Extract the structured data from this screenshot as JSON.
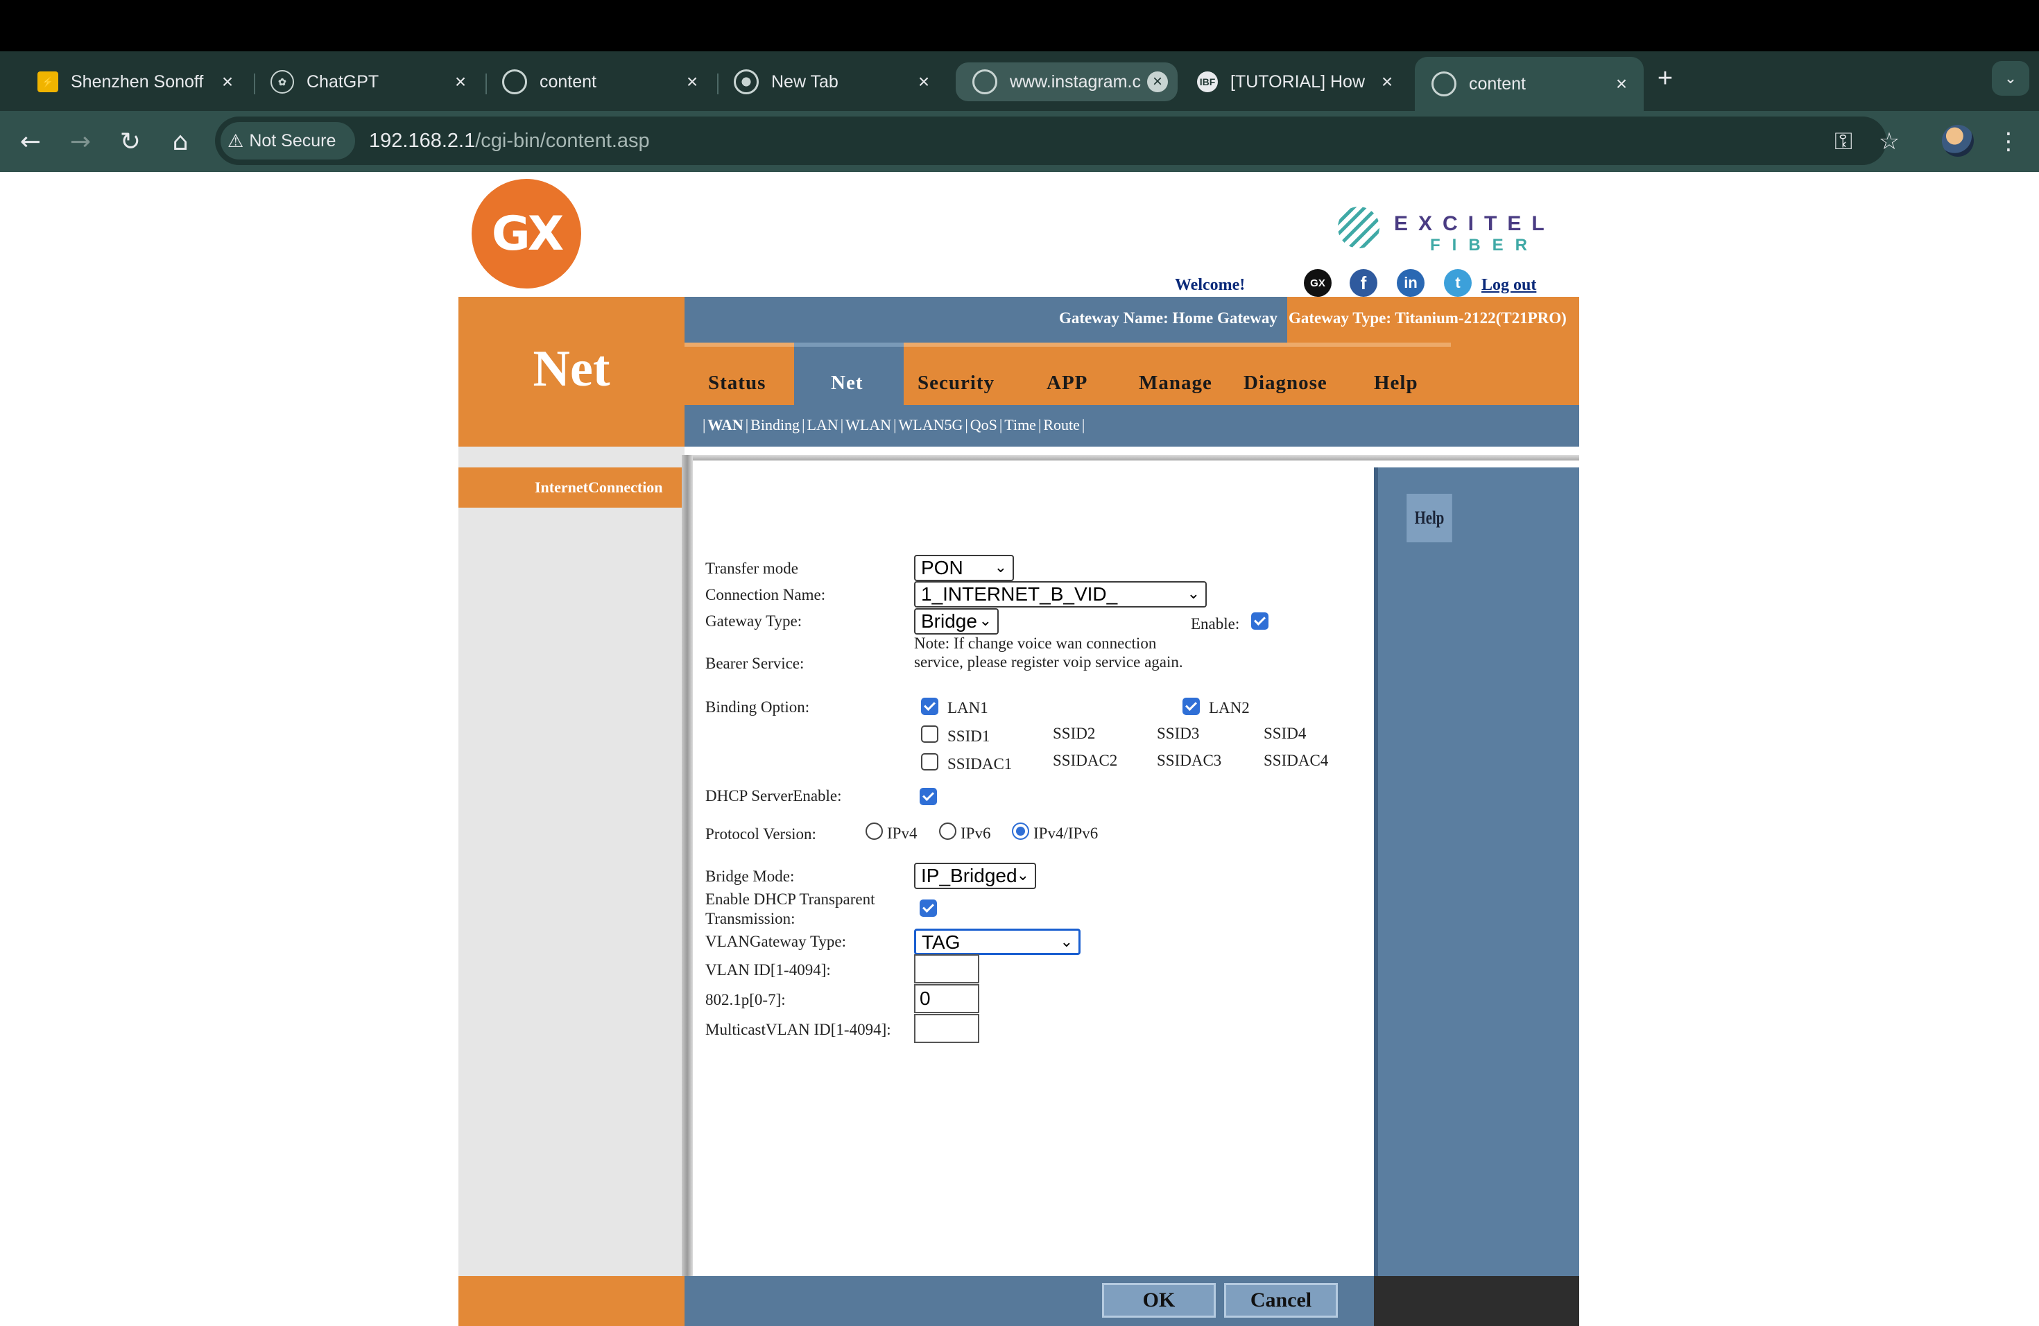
{
  "browser": {
    "tabs": [
      {
        "title": "Shenzhen Sonoff",
        "icon": "sonoff-icon"
      },
      {
        "title": "ChatGPT",
        "icon": "chatgpt-icon"
      },
      {
        "title": "content",
        "icon": "globe-icon"
      },
      {
        "title": "New Tab",
        "icon": "chrome-icon"
      },
      {
        "title": "www.instagram.c",
        "icon": "globe-icon"
      },
      {
        "title": "[TUTORIAL] How",
        "icon": "ibf-icon"
      },
      {
        "title": "content",
        "icon": "globe-icon"
      }
    ],
    "active_tab": 6,
    "security_label": "Not Secure",
    "url_host": "192.168.2.1",
    "url_path": "/cgi-bin/content.asp",
    "colors": {
      "tabbar": "#1f3532",
      "toolbar": "#31514d"
    }
  },
  "header": {
    "logo_text": "GX",
    "brand_line1": "EXCITEL",
    "brand_line2": "FIBER",
    "welcome": "Welcome!",
    "social_icons": [
      "gx-icon",
      "facebook-icon",
      "linkedin-icon",
      "twitter-icon"
    ],
    "social_glyphs": {
      "gx": "GX",
      "facebook": "f",
      "linkedin": "in",
      "twitter": "t"
    },
    "logout": "Log out",
    "page_name": "Net",
    "gateway_name": "Gateway Name: Home Gateway",
    "gateway_type": "Gateway Type: Titanium-2122(T21PRO)"
  },
  "menu": {
    "items": [
      "Status",
      "Net",
      "Security",
      "APP",
      "Manage",
      "Diagnose",
      "Help"
    ],
    "active": "Net",
    "submenu": [
      "WAN",
      "Binding",
      "LAN",
      "WLAN",
      "WLAN5G",
      "QoS",
      "Time",
      "Route"
    ],
    "submenu_active": "WAN"
  },
  "sidebar": {
    "item": "InternetConnection"
  },
  "form": {
    "transfer_mode": {
      "label": "Transfer mode",
      "value": "PON"
    },
    "connection_name": {
      "label": "Connection Name:",
      "value": "1_INTERNET_B_VID_"
    },
    "gateway_type": {
      "label": "Gateway Type:",
      "value": "Bridge"
    },
    "enable": {
      "label": "Enable:",
      "checked": true
    },
    "bearer_service": {
      "label": "Bearer Service:",
      "note": "Note: If change voice wan connection service, please register voip service again."
    },
    "binding": {
      "label": "Binding Option:",
      "lan1": {
        "label": "LAN1",
        "checked": true
      },
      "lan2": {
        "label": "LAN2",
        "checked": true
      },
      "ssid1": {
        "label": "SSID1",
        "checked": false
      },
      "ssid_plain": [
        "SSID2",
        "SSID3",
        "SSID4"
      ],
      "ssidac1": {
        "label": "SSIDAC1",
        "checked": false
      },
      "ssidac_plain": [
        "SSIDAC2",
        "SSIDAC3",
        "SSIDAC4"
      ]
    },
    "dhcp_server": {
      "label": "DHCP ServerEnable:",
      "checked": true
    },
    "protocol": {
      "label": "Protocol Version:",
      "options": [
        "IPv4",
        "IPv6",
        "IPv4/IPv6"
      ],
      "selected": "IPv4/IPv6"
    },
    "bridge_mode": {
      "label": "Bridge Mode:",
      "value": "IP_Bridged"
    },
    "dhcp_transparent": {
      "label_line1": "Enable DHCP Transparent",
      "label_line2": "Transmission:",
      "checked": true
    },
    "vlan_gateway_type": {
      "label": "VLANGateway Type:",
      "value": "TAG"
    },
    "vlan_id": {
      "label": "VLAN ID[1-4094]:",
      "value": ""
    },
    "dot1p": {
      "label": "802.1p[0-7]:",
      "value": "0"
    },
    "multicast_vlan": {
      "label": "MulticastVLAN ID[1-4094]:",
      "value": ""
    }
  },
  "help_button": "Help",
  "buttons": {
    "ok": "OK",
    "cancel": "Cancel"
  },
  "colors": {
    "orange": "#e38937",
    "blue": "#57799a",
    "logo_orange": "#e9742a"
  }
}
